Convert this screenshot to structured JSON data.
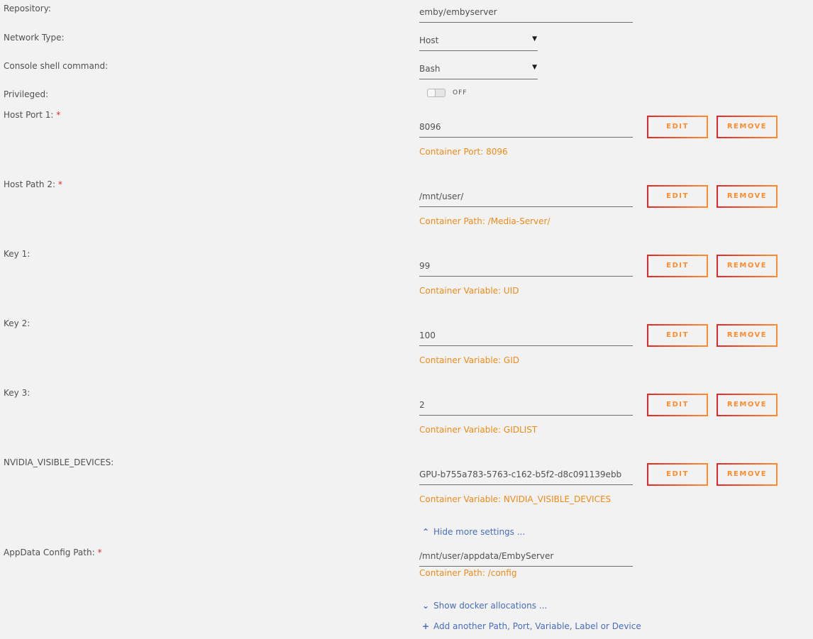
{
  "rows": {
    "repository": {
      "label": "Repository:",
      "value": "emby/embyserver"
    },
    "network_type": {
      "label": "Network Type:",
      "value": "Host"
    },
    "console_shell": {
      "label": "Console shell command:",
      "value": "Bash"
    },
    "privileged": {
      "label": "Privileged:",
      "state": "OFF"
    }
  },
  "mappings": [
    {
      "label": "Host Port 1:",
      "required": "*",
      "value": "8096",
      "container": "Container Port: 8096"
    },
    {
      "label": "Host Path 2:",
      "required": "*",
      "value": "/mnt/user/",
      "container": "Container Path: /Media-Server/"
    },
    {
      "label": "Key 1:",
      "required": "",
      "value": "99",
      "container": "Container Variable: UID"
    },
    {
      "label": "Key 2:",
      "required": "",
      "value": "100",
      "container": "Container Variable: GID"
    },
    {
      "label": "Key 3:",
      "required": "",
      "value": "2",
      "container": "Container Variable: GIDLIST"
    },
    {
      "label": "NVIDIA_VISIBLE_DEVICES:",
      "required": "",
      "value": "GPU-b755a783-5763-c162-b5f2-d8c091139ebb",
      "container": "Container Variable: NVIDIA_VISIBLE_DEVICES"
    }
  ],
  "buttons": {
    "edit": "EDIT",
    "remove": "REMOVE"
  },
  "links": {
    "hide_more": "Hide more settings ...",
    "show_alloc": "Show docker allocations ...",
    "add_another": "Add another Path, Port, Variable, Label or Device"
  },
  "appdata": {
    "label": "AppData Config Path:",
    "required": "*",
    "value": "/mnt/user/appdata/EmbyServer",
    "container": "Container Path: /config"
  },
  "icons": {
    "chevron_up": "chevron-up-icon",
    "chevron_down": "chevron-down-icon",
    "plus": "plus-icon",
    "caret": "caret-down-icon"
  },
  "colors": {
    "accent_orange": "#f08a17",
    "button_gradient_start": "#e22828",
    "button_gradient_end": "#ff8c2f",
    "link_blue": "#486dba",
    "required_red": "#e22828",
    "background": "#f2f2f2"
  }
}
